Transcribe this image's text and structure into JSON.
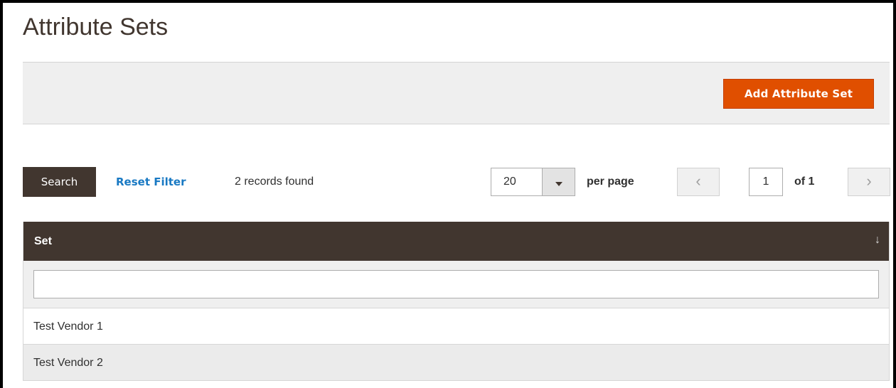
{
  "page": {
    "title": "Attribute Sets"
  },
  "actions": {
    "add_label": "Add Attribute Set"
  },
  "toolbar": {
    "search_label": "Search",
    "reset_label": "Reset Filter",
    "records_found": "2 records found",
    "per_page_value": "20",
    "per_page_label": "per page",
    "prev_icon": "‹",
    "next_icon": "›",
    "current_page": "1",
    "page_of": "of 1"
  },
  "grid": {
    "columns": [
      {
        "label": "Set",
        "sort_indicator": "↓"
      }
    ],
    "filter_value": "",
    "rows": [
      {
        "set": "Test Vendor 1"
      },
      {
        "set": "Test Vendor 2"
      }
    ]
  },
  "colors": {
    "accent": "#e04f00",
    "header_bg": "#41362f",
    "link": "#1979c3"
  }
}
